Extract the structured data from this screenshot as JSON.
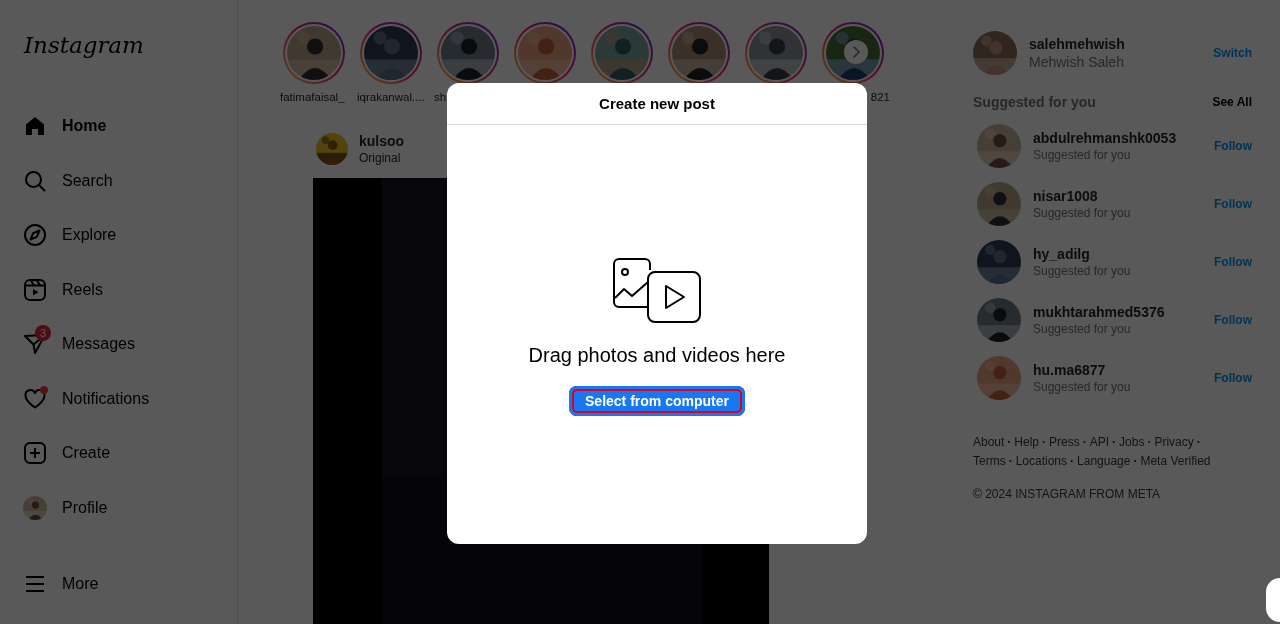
{
  "sidebar": {
    "logo": "Instagram",
    "items": [
      {
        "kind": "home",
        "label": "Home",
        "selected": true
      },
      {
        "kind": "search",
        "label": "Search",
        "selected": false
      },
      {
        "kind": "explore",
        "label": "Explore",
        "selected": false
      },
      {
        "kind": "reels",
        "label": "Reels",
        "selected": false
      },
      {
        "kind": "messages",
        "label": "Messages",
        "selected": false,
        "badge": "3"
      },
      {
        "kind": "notifications",
        "label": "Notifications",
        "selected": false,
        "has_dot": true
      },
      {
        "kind": "create",
        "label": "Create",
        "selected": false
      },
      {
        "kind": "profile",
        "label": "Profile",
        "selected": false
      }
    ],
    "more": {
      "label": "More"
    }
  },
  "stories": [
    {
      "kind": "story",
      "label": "fatimafaisal_"
    },
    {
      "kind": "story",
      "label": "iqrakanwal...."
    },
    {
      "kind": "story",
      "label": "sh"
    },
    {
      "kind": "story"
    },
    {
      "kind": "story"
    },
    {
      "kind": "story"
    },
    {
      "kind": "story"
    },
    {
      "kind": "story",
      "label": "821"
    }
  ],
  "post": {
    "user": "kulsoo",
    "subtitle": "Original"
  },
  "modal": {
    "title": "Create new post",
    "prompt": "Drag photos and videos here",
    "button": {
      "label": "Select from computer",
      "highlighted": true
    }
  },
  "account": {
    "username": "salehmehwish",
    "name": "Mehwish Saleh",
    "action": "Switch"
  },
  "suggestions": {
    "title": "Suggested for you",
    "see_all": "See All",
    "items": [
      {
        "username": "abdulrehmanshk0053",
        "subtitle": "Suggested for you",
        "action": "Follow"
      },
      {
        "username": "nisar1008",
        "subtitle": "Suggested for you",
        "action": "Follow"
      },
      {
        "username": "hy_adilg",
        "subtitle": "Suggested for you",
        "action": "Follow"
      },
      {
        "username": "mukhtarahmed5376",
        "subtitle": "Suggested for you",
        "action": "Follow"
      },
      {
        "username": "hu.ma6877",
        "subtitle": "Suggested for you",
        "action": "Follow"
      }
    ]
  },
  "footer": {
    "separator": "·",
    "links": [
      "About",
      "Help",
      "Press",
      "API",
      "Jobs",
      "Privacy",
      "Terms",
      "Locations",
      "Language",
      "Meta Verified"
    ],
    "copyright": "© 2024 INSTAGRAM FROM META"
  }
}
